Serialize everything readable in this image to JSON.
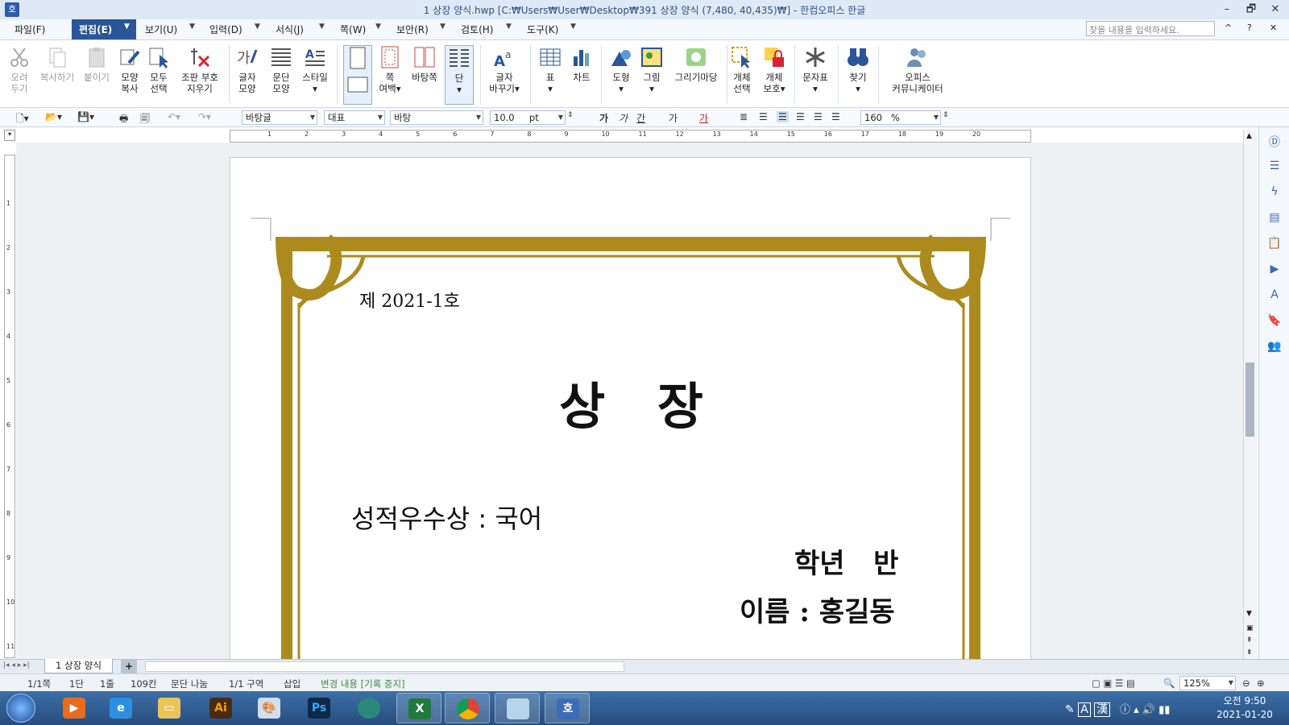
{
  "window": {
    "title": "1 상장 양식.hwp [C:₩Users₩User₩Desktop₩391 상장 양식 (7,480, 40,435)₩] - 한컴오피스 한글",
    "logo": "호",
    "minimize": "–",
    "restore": "🗗",
    "close": "✕"
  },
  "menu": {
    "items": [
      "파일(F)",
      "편집(E)",
      "보기(U)",
      "입력(D)",
      "서식(J)",
      "쪽(W)",
      "보안(R)",
      "검토(H)",
      "도구(K)"
    ],
    "search_placeholder": "찾을 내용을 입력하세요.",
    "help": "?",
    "collapse": "^",
    "close": "✕"
  },
  "ribbon": {
    "cut": [
      "오려",
      "두기"
    ],
    "copy": "복사하기",
    "paste": "붙이기",
    "format_copy": [
      "모양",
      "복사"
    ],
    "select_all": [
      "모두",
      "선택"
    ],
    "erase_marks": [
      "조판 부호",
      "지우기"
    ],
    "char_shape": [
      "글자",
      "모양"
    ],
    "para_shape": [
      "문단",
      "모양"
    ],
    "style": "스타일",
    "page_margin": [
      "쪽",
      "여백"
    ],
    "background": "바탕쪽",
    "column": "단",
    "change_char": [
      "글자",
      "바꾸기"
    ],
    "table": "표",
    "chart": "차트",
    "shape": "도형",
    "picture": "그림",
    "drawing": "그리기마당",
    "obj_select": [
      "개체",
      "선택"
    ],
    "obj_protect": [
      "개체",
      "보호"
    ],
    "char_table": "문자표",
    "find": "찾기",
    "community": [
      "오피스",
      "커뮤니케이터"
    ]
  },
  "format": {
    "style": "바탕글",
    "lang": "대표",
    "font": "바탕",
    "size": "10.0",
    "unit": "pt",
    "bold": "가",
    "italic": "가",
    "underline": "간",
    "strike": "가",
    "color": "가",
    "spacing": "160",
    "percent": "%"
  },
  "ruler": {
    "ticks": [
      "1",
      "2",
      "3",
      "4",
      "5",
      "6",
      "7",
      "8",
      "9",
      "10",
      "11",
      "12",
      "13",
      "14",
      "15",
      "16",
      "17",
      "18",
      "19",
      "20"
    ],
    "vticks": [
      "1",
      "2",
      "3",
      "4",
      "5",
      "6",
      "7",
      "8",
      "9",
      "10",
      "11"
    ]
  },
  "document": {
    "number": "제 2021-1호",
    "title": "상   장",
    "award": "성적우수상 : 국어",
    "grade": "학년   반",
    "name": "이름 : 홍길동"
  },
  "tabs": {
    "sheet": "1 상장 양식",
    "add": "+"
  },
  "status": {
    "page": "1/1쪽",
    "column": "1단",
    "line": "1줄",
    "char": "109칸",
    "break": "문단 나눔",
    "section": "1/1 구역",
    "insert": "삽입",
    "track": "변경 내용 [기록 중지]",
    "zoom": "125%"
  },
  "taskbar": {
    "clock_time": "오전 9:50",
    "clock_date": "2021-01-20",
    "ime1": "A",
    "ime2": "漢"
  },
  "colors": {
    "accent": "#2a5699",
    "frame_gold": "#ad8a1e",
    "track_text": "#3c8f3c"
  }
}
